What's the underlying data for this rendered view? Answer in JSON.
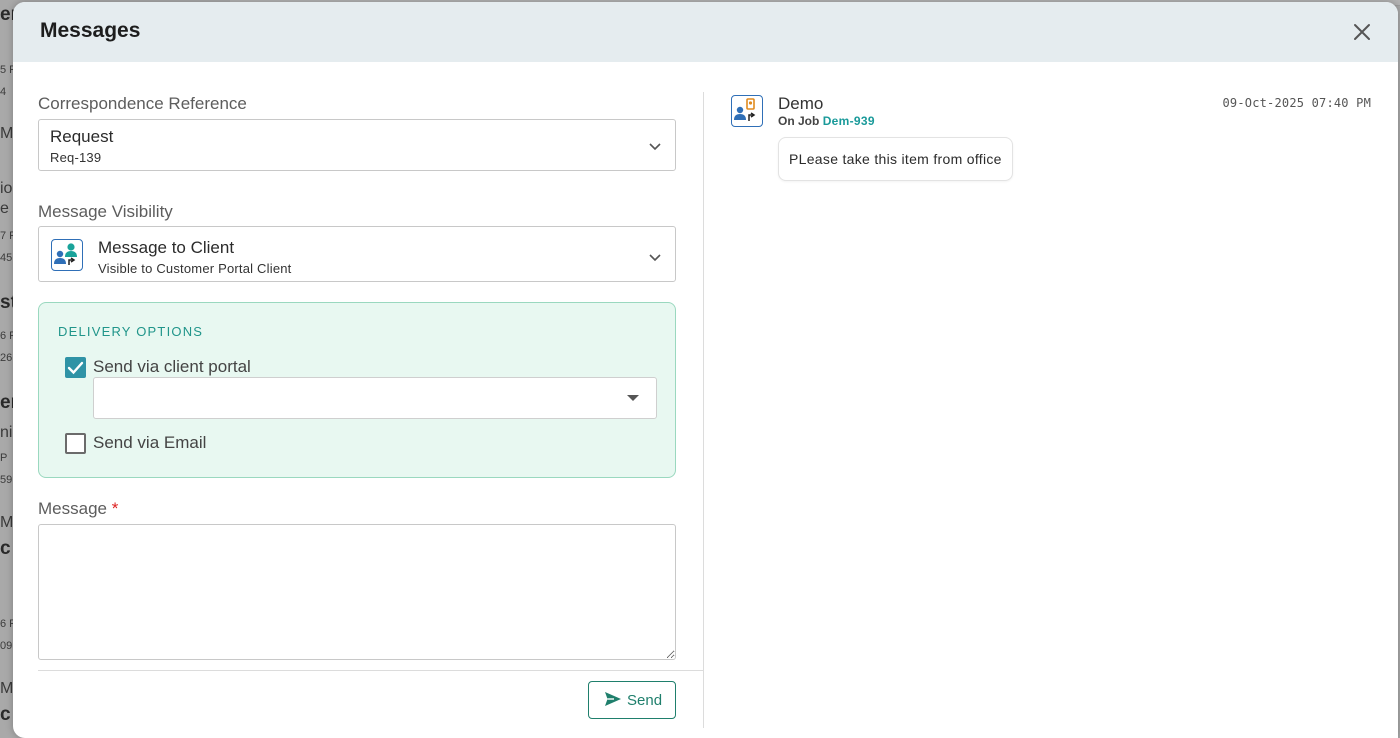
{
  "background": {
    "fragments": [
      "er",
      "5 P",
      "4",
      "M",
      "io",
      "e",
      "7 P",
      "45",
      "st",
      "6 P",
      "26",
      "er",
      "nir",
      "P",
      "59",
      "M",
      "c",
      "6 P",
      "09",
      "M",
      "c"
    ]
  },
  "modal": {
    "title": "Messages",
    "close_icon": "close-icon"
  },
  "form": {
    "correspondence": {
      "label": "Correspondence Reference",
      "value_main": "Request",
      "value_sub": "Req-139"
    },
    "visibility": {
      "label": "Message Visibility",
      "value_main": "Message to Client",
      "value_sub": "Visible to Customer Portal Client",
      "icon": "client-portal-icon"
    },
    "delivery": {
      "title": "DELIVERY OPTIONS",
      "portal_label": "Send via client portal",
      "portal_checked": true,
      "portal_select_value": "",
      "email_label": "Send via Email",
      "email_checked": false
    },
    "message": {
      "label": "Message",
      "required_mark": "*",
      "value": ""
    },
    "send_label": "Send"
  },
  "thread": {
    "messages": [
      {
        "sender": "Demo",
        "job_prefix": "On Job",
        "job_ref": "Dem-939",
        "timestamp": "09-Oct-2025 07:40 PM",
        "text": "PLease take this item from office"
      }
    ]
  },
  "colors": {
    "header_bg": "#e5ecef",
    "accent_teal": "#20958a",
    "checkbox_checked": "#2f93a6",
    "delivery_bg": "#e8f8f1",
    "send_border": "#1f7f6c"
  }
}
